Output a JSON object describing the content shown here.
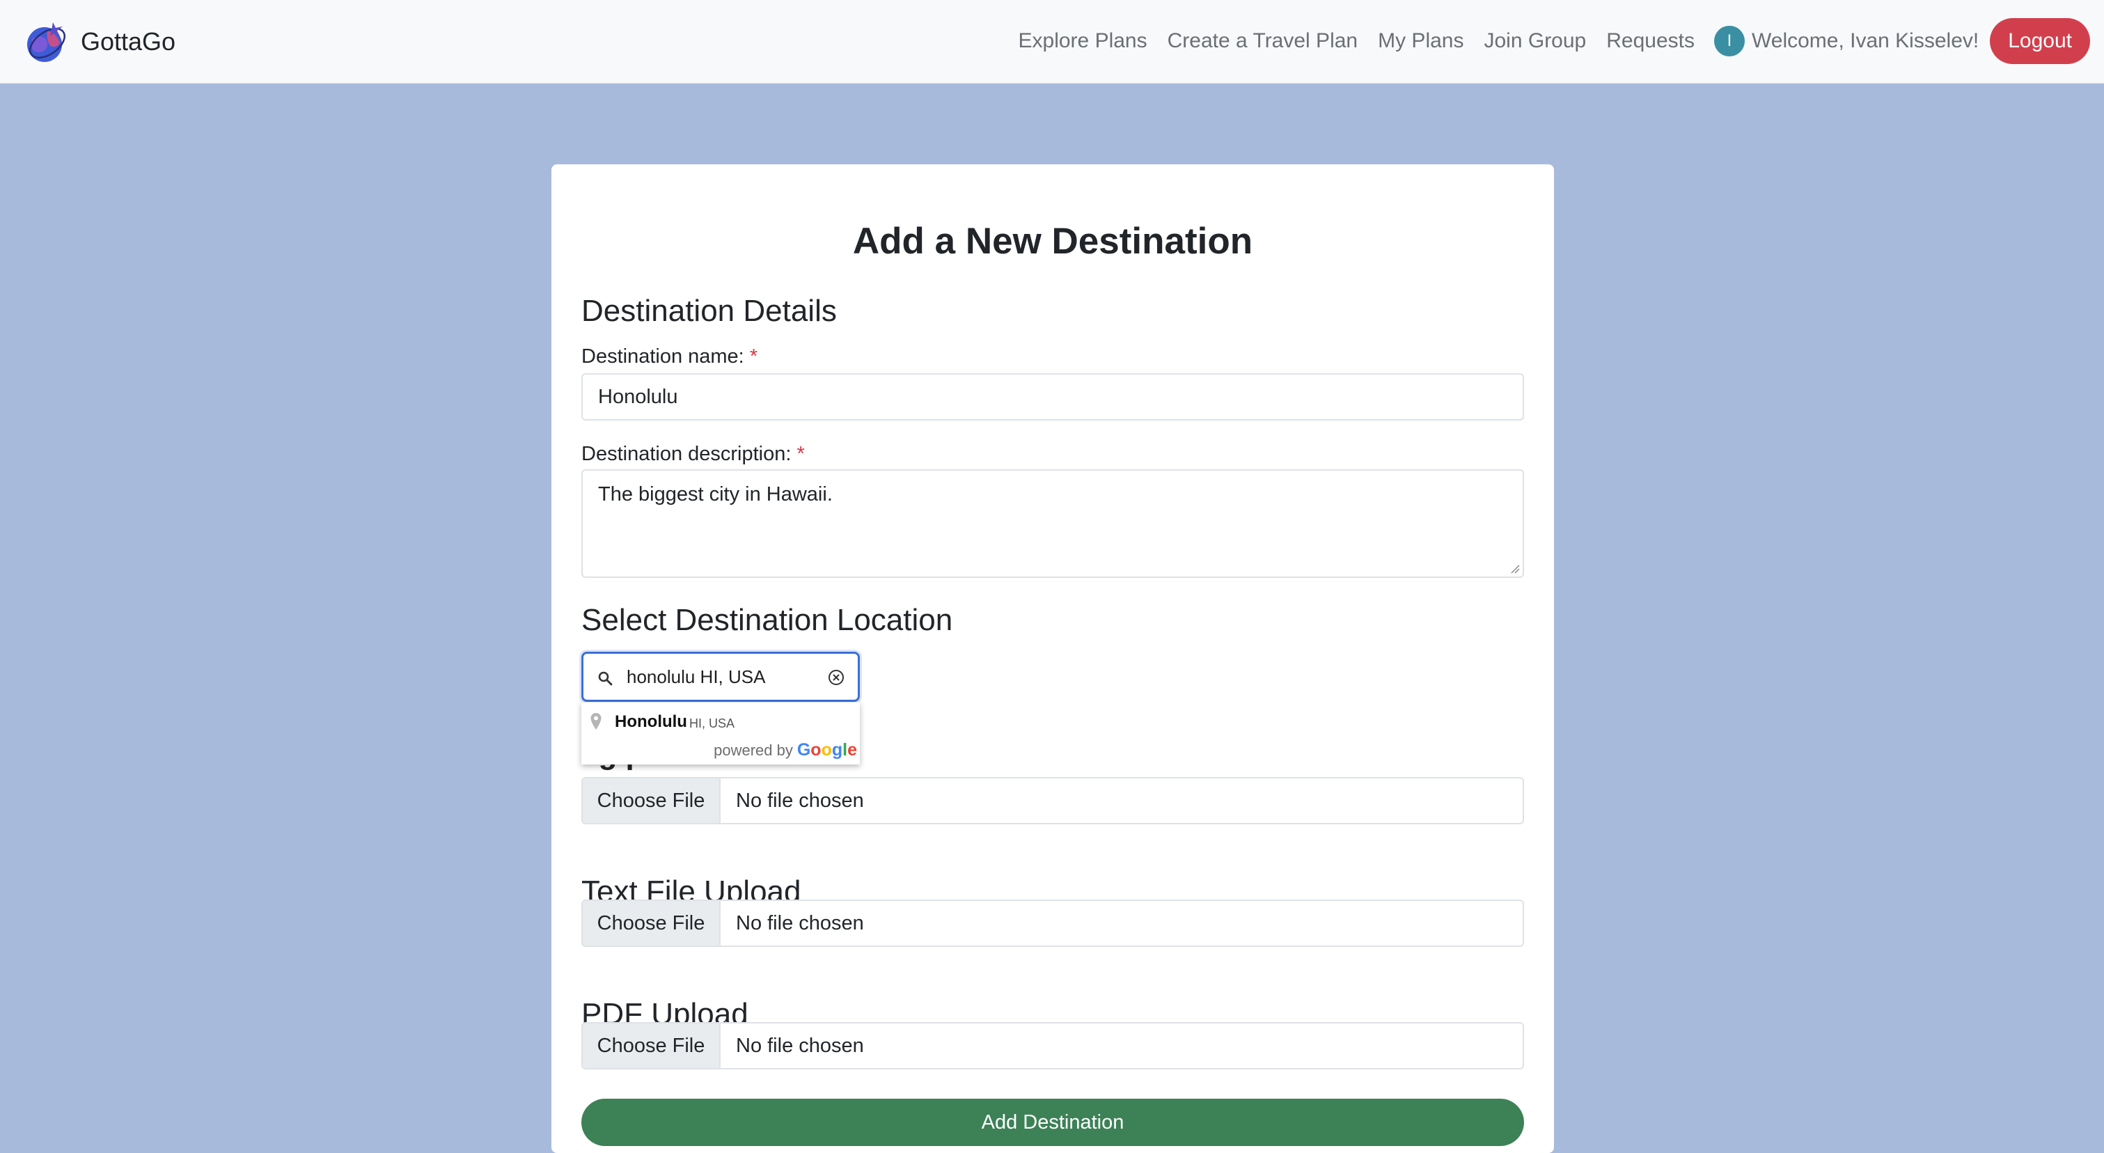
{
  "brand": {
    "name": "GottaGo"
  },
  "nav": {
    "links": [
      "Explore Plans",
      "Create a Travel Plan",
      "My Plans",
      "Join Group",
      "Requests"
    ],
    "avatar_initial": "I",
    "welcome": "Welcome, Ivan Kisselev!",
    "logout": "Logout"
  },
  "form": {
    "title": "Add a New Destination",
    "details_heading": "Destination Details",
    "name_label": "Destination name:",
    "name_value": "Honolulu",
    "description_label": "Destination description:",
    "description_value": "The biggest city in Hawaii.",
    "required_mark": "*",
    "location_heading": "Select Destination Location",
    "location_search_value": "honolulu HI, USA",
    "image_heading_partial": "I  g  p",
    "text_upload_heading": "Text File Upload",
    "pdf_upload_heading": "PDF Upload",
    "choose_file": "Choose File",
    "no_file": "No file chosen",
    "submit": "Add Destination"
  },
  "autocomplete": {
    "suggestion_main": "Honolulu",
    "suggestion_secondary": "HI, USA",
    "powered_by": "powered by",
    "google_letters": [
      "G",
      "o",
      "o",
      "g",
      "l",
      "e"
    ]
  },
  "colors": {
    "page_bg": "#a7badc",
    "logout": "#d23f4c",
    "submit": "#3d8157",
    "focus_border": "#3b6fd9",
    "avatar": "#3a8fa3"
  }
}
